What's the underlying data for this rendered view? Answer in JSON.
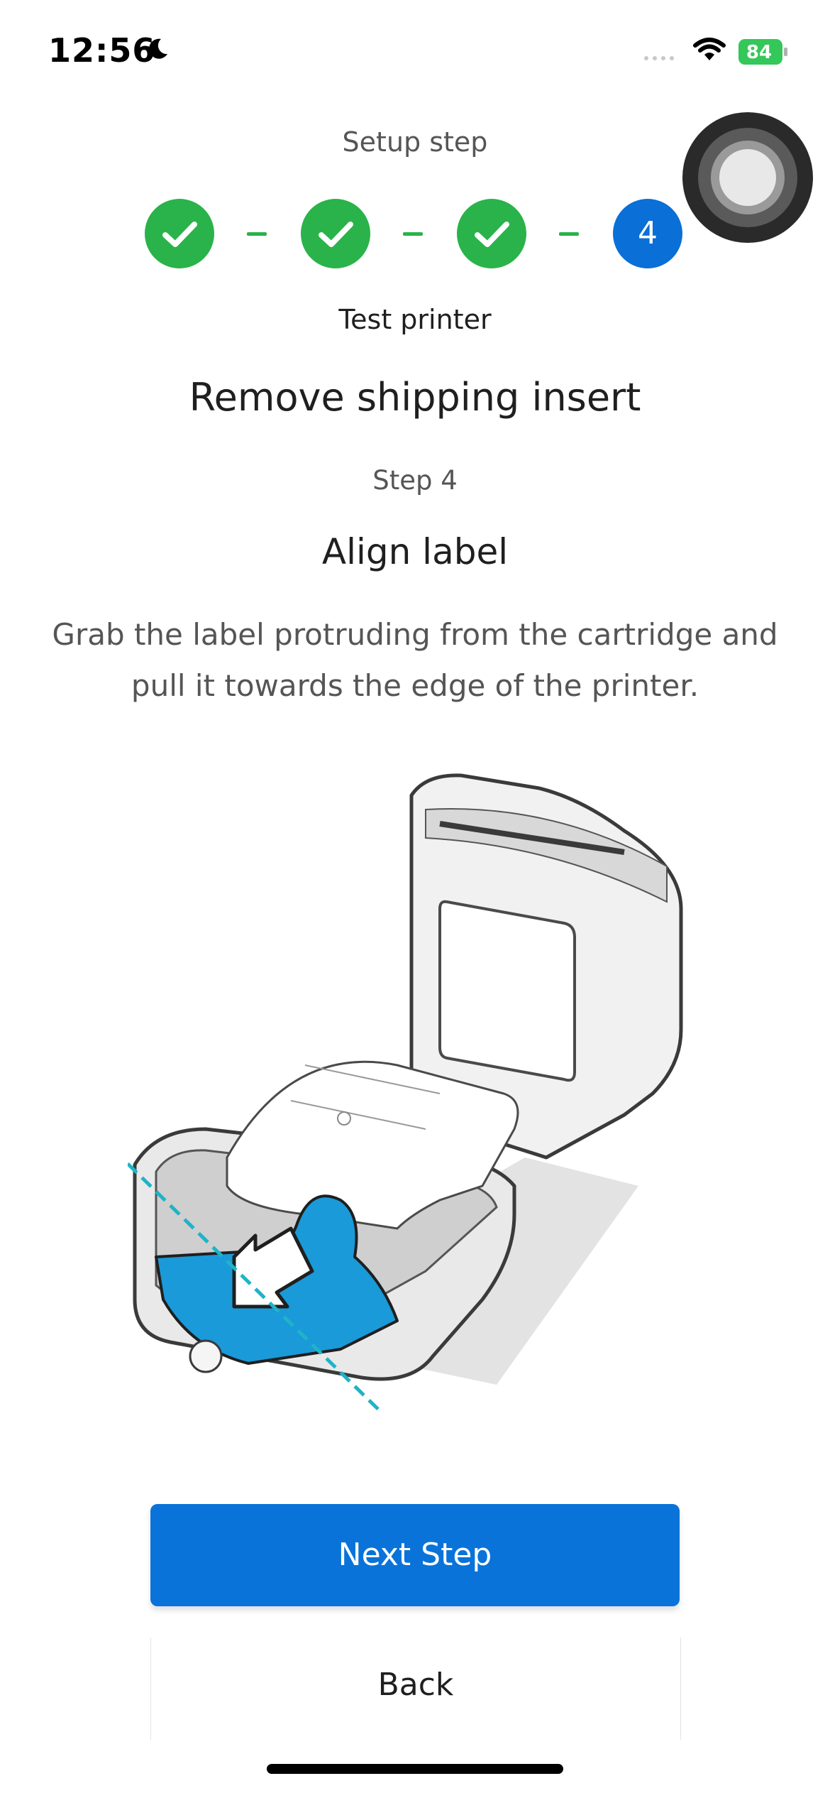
{
  "status_bar": {
    "time": "12:56",
    "battery": "84",
    "icons": [
      "moon-icon",
      "signal-icon",
      "wifi-icon",
      "battery-icon"
    ]
  },
  "setup": {
    "label": "Setup step",
    "steps": [
      {
        "state": "done",
        "icon": "checkmark-icon"
      },
      {
        "state": "done",
        "icon": "checkmark-icon"
      },
      {
        "state": "done",
        "icon": "checkmark-icon"
      },
      {
        "state": "current",
        "number": "4"
      }
    ],
    "current_step_name": "Test printer"
  },
  "content": {
    "title": "Remove shipping insert",
    "step_number": "Step 4",
    "subtitle": "Align label",
    "description": "Grab the label protruding from the cartridge and pull it towards the edge of the printer."
  },
  "buttons": {
    "next": "Next Step",
    "back": "Back"
  },
  "colors": {
    "accent": "#0a73d9",
    "success": "#29b34a",
    "label_blue": "#1a9ad9",
    "guide_line": "#1fb3c7"
  }
}
